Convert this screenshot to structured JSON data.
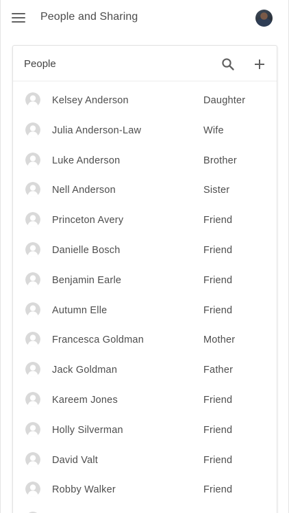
{
  "appbar": {
    "title": "People and Sharing",
    "menu_icon": "hamburger-menu-icon",
    "avatar_icon": "user-avatar"
  },
  "card": {
    "title": "People",
    "search_icon": "search-icon",
    "add_icon": "add-icon"
  },
  "people": [
    {
      "name": "Kelsey Anderson",
      "relation": "Daughter"
    },
    {
      "name": "Julia Anderson-Law",
      "relation": "Wife"
    },
    {
      "name": "Luke Anderson",
      "relation": "Brother"
    },
    {
      "name": "Nell Anderson",
      "relation": "Sister"
    },
    {
      "name": "Princeton Avery",
      "relation": "Friend"
    },
    {
      "name": "Danielle Bosch",
      "relation": "Friend"
    },
    {
      "name": "Benjamin Earle",
      "relation": "Friend"
    },
    {
      "name": "Autumn Elle",
      "relation": "Friend"
    },
    {
      "name": "Francesca Goldman",
      "relation": "Mother"
    },
    {
      "name": "Jack Goldman",
      "relation": "Father"
    },
    {
      "name": "Kareem Jones",
      "relation": "Friend"
    },
    {
      "name": "Holly Silverman",
      "relation": "Friend"
    },
    {
      "name": "David Valt",
      "relation": "Friend"
    },
    {
      "name": "Robby Walker",
      "relation": "Friend"
    },
    {
      "name": "",
      "relation": ""
    }
  ],
  "colors": {
    "text": "#4d4d4d",
    "icon": "#616161",
    "divider": "#ececec",
    "avatar_bg": "#d9d9d9"
  }
}
